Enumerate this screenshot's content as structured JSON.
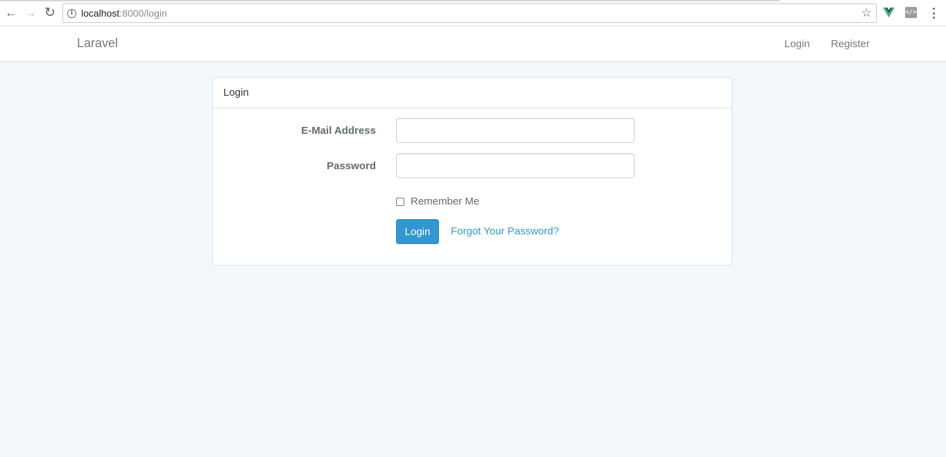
{
  "browser": {
    "url_host": "localhost",
    "url_path": ":8000/login",
    "icons": [
      "back-icon",
      "forward-icon",
      "reload-icon",
      "info-icon",
      "star-icon",
      "vue-devtools-icon",
      "code-extension-icon",
      "menu-icon"
    ],
    "back_glyph": "←",
    "forward_glyph": "→",
    "reload_glyph": "↻",
    "info_glyph": "i",
    "star_glyph": "☆",
    "code_glyph": "</>"
  },
  "navbar": {
    "brand": "Laravel",
    "links": [
      "Login",
      "Register"
    ]
  },
  "panel": {
    "heading": "Login",
    "email_label": "E-Mail Address",
    "email_value": "",
    "password_label": "Password",
    "password_value": "",
    "remember_label": "Remember Me",
    "remember_checked": false,
    "submit_label": "Login",
    "forgot_label": "Forgot Your Password?"
  },
  "colors": {
    "background": "#f5f8fa",
    "primary": "#3097d1",
    "border": "#d3e0e9",
    "text": "#636b6f"
  }
}
